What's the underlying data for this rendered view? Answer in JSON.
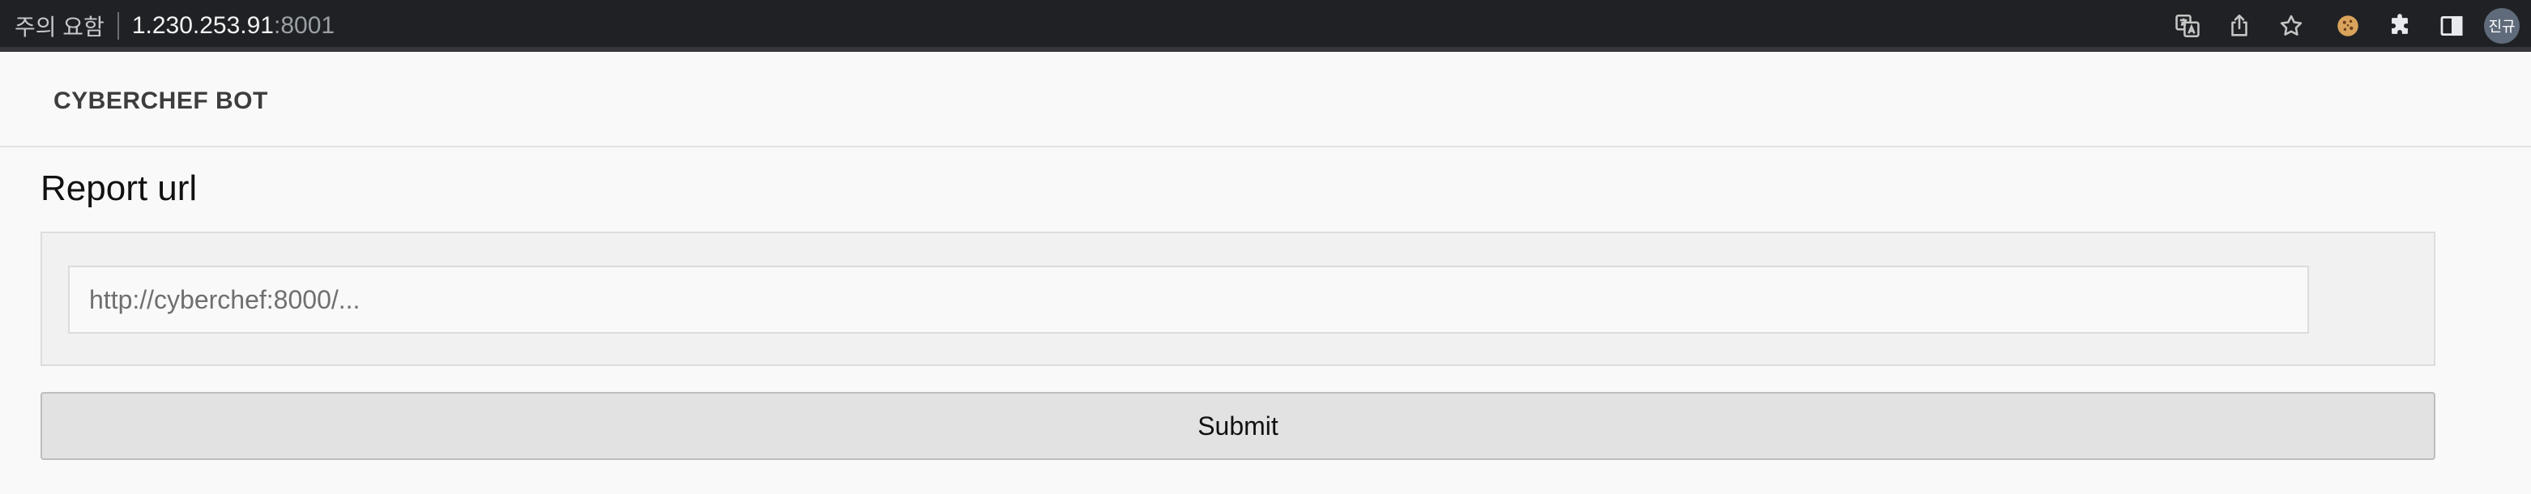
{
  "browser": {
    "security_text": "주의 요함",
    "url_host": "1.230.253.91",
    "url_port": ":8001",
    "icons": [
      "translate-icon",
      "share-icon",
      "star-icon",
      "cookie-icon",
      "extensions-icon",
      "sidepanel-icon"
    ],
    "profile_label": "진규"
  },
  "navbar": {
    "brand": "CYBERCHEF BOT"
  },
  "main": {
    "title": "Report url",
    "url_input": {
      "placeholder": "http://cyberchef:8000/...",
      "value": ""
    },
    "submit_label": "Submit"
  }
}
